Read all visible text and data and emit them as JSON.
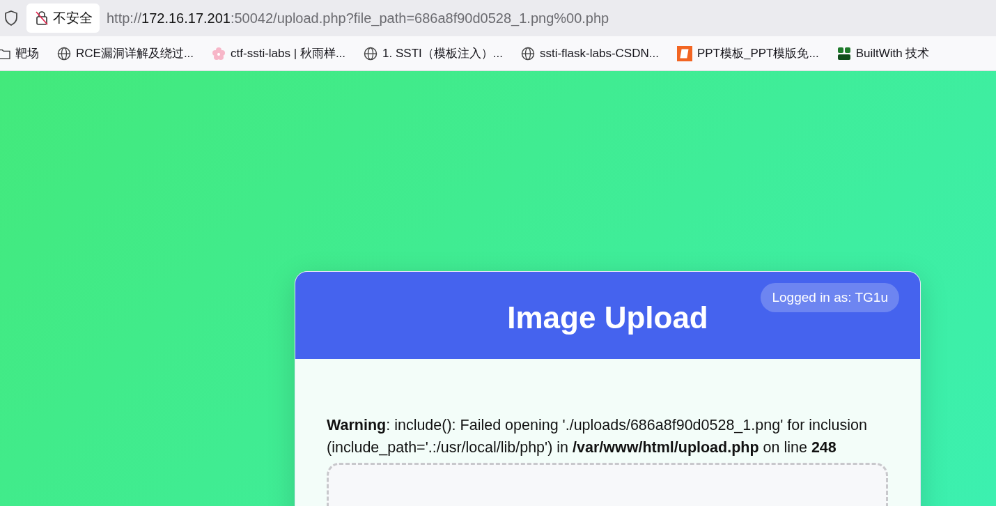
{
  "browser": {
    "security_label": "不安全",
    "url": {
      "scheme": "http://",
      "host": "172.16.17.201",
      "rest": ":50042/upload.php?file_path=686a8f90d0528_1.png%00.php"
    },
    "bookmarks": [
      {
        "kind": "folder",
        "label": "靶场"
      },
      {
        "kind": "globe",
        "label": "RCE漏洞详解及绕过..."
      },
      {
        "kind": "flower",
        "label": "ctf-ssti-labs | 秋雨样..."
      },
      {
        "kind": "globe",
        "label": "1. SSTI（模板注入）..."
      },
      {
        "kind": "globe",
        "label": "ssti-flask-labs-CSDN..."
      },
      {
        "kind": "slides",
        "label": "PPT模板_PPT模版免..."
      },
      {
        "kind": "builtwith",
        "label": "BuiltWith 技术"
      }
    ]
  },
  "card": {
    "title": "Image Upload",
    "user_badge": "Logged in as: TG1u",
    "warning": "**Warning**: include(): Failed opening './uploads/686a8f90d0528_1.png' for inclusion (include_path='.:/usr/local/lib/php') in **/var/www/html/upload.php** on line **248**"
  }
}
